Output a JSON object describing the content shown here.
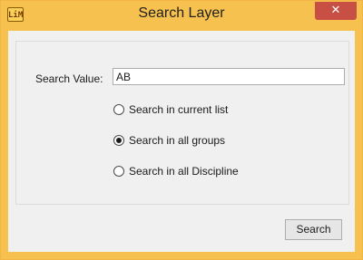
{
  "window": {
    "title": "Search Layer",
    "app_icon_text": "LiM",
    "close_symbol": "✕"
  },
  "form": {
    "search_label": "Search Value:",
    "search_value": "AB",
    "options": [
      {
        "label": "Search in current list",
        "checked": false
      },
      {
        "label": "Search in all groups",
        "checked": true
      },
      {
        "label": "Search in all Discipline",
        "checked": false
      }
    ]
  },
  "buttons": {
    "search_label": "Search"
  },
  "colors": {
    "frame": "#f7c14f",
    "close": "#c74f44",
    "client": "#f0f0f0"
  },
  "icons": {
    "app": "app-logo-icon",
    "close": "close-icon"
  }
}
